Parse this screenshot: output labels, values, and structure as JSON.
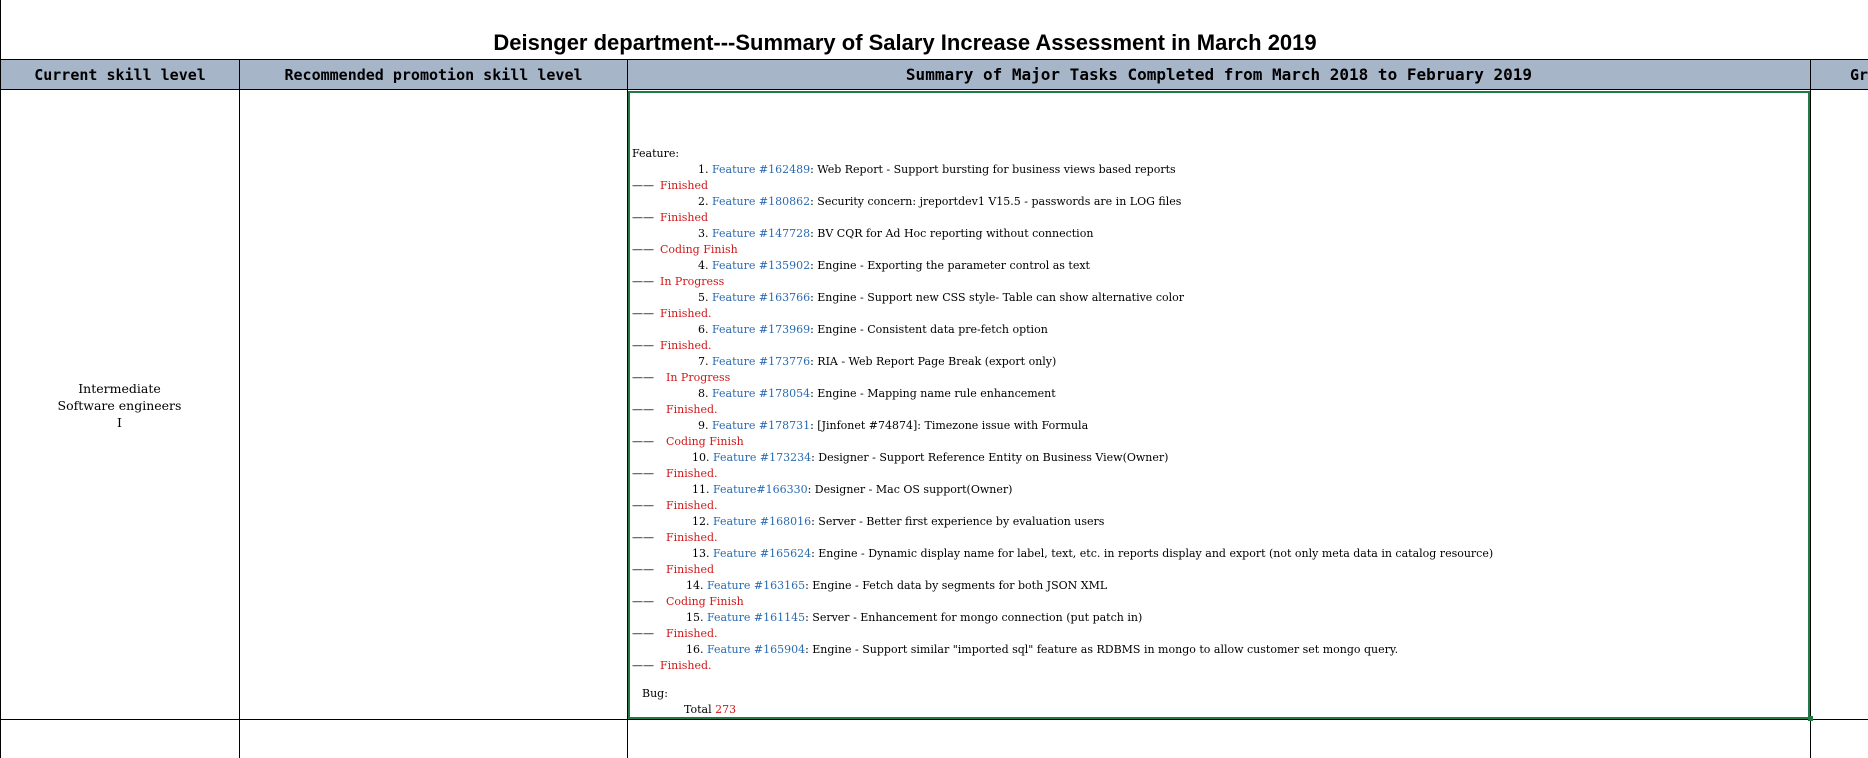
{
  "title": "Deisnger department---Summary of Salary Increase Assessment in March 2019",
  "headers": {
    "col1": "Current skill level",
    "col2": "Recommended promotion skill level",
    "col3": "Summary of Major Tasks Completed from March 2018 to February 2019",
    "col4_partial": "Gr"
  },
  "row": {
    "current_level": [
      "Intermediate",
      "Software engineers",
      "I"
    ],
    "recommended_level": ""
  },
  "tasks": {
    "feature_heading": "Feature:",
    "items": [
      {
        "num": "1.",
        "link": "Feature #162489",
        "desc": ": Web Report - Support bursting for business views based reports",
        "status": "Finished"
      },
      {
        "num": "2.",
        "link": "Feature #180862",
        "desc": ": Security concern: jreportdev1 V15.5 - passwords are in LOG files",
        "status": "Finished"
      },
      {
        "num": "3.",
        "link": "Feature #147728",
        "desc": ": BV CQR for Ad Hoc reporting without connection",
        "status": "Coding Finish"
      },
      {
        "num": "4.",
        "link": "Feature #135902",
        "desc": ": Engine - Exporting the parameter control as text",
        "status": "In Progress"
      },
      {
        "num": "5.",
        "link": "Feature #163766",
        "desc": ": Engine - Support new CSS style- Table can show alternative color",
        "status": "Finished."
      },
      {
        "num": "6.",
        "link": "Feature #173969",
        "desc": ": Engine - Consistent data pre-fetch option",
        "status": "Finished."
      },
      {
        "num": "7.",
        "link": "Feature #173776",
        "desc": ": RIA - Web Report Page Break (export only)",
        "status": "In Progress"
      },
      {
        "num": "8.",
        "link": "Feature #178054",
        "desc": ": Engine - Mapping name rule enhancement",
        "status": "Finished."
      },
      {
        "num": "9.",
        "link": "Feature #178731",
        "desc": ": [Jinfonet #74874]: Timezone issue with Formula",
        "status": "Coding Finish"
      },
      {
        "num": "10.",
        "link": "Feature #173234",
        "desc": ": Designer - Support Reference Entity on Business View(Owner)",
        "status": "Finished."
      },
      {
        "num": "11.",
        "link": "Feature#166330",
        "desc": ": Designer - Mac OS support(Owner)",
        "status": "Finished."
      },
      {
        "num": "12.",
        "link": "Feature #168016",
        "desc": ": Server - Better first experience by evaluation users",
        "status": "Finished."
      },
      {
        "num": "13.",
        "link": "Feature #165624",
        "desc": ": Engine - Dynamic display name for label, text, etc. in reports display and export (not only meta data in catalog resource)",
        "status": "Finished"
      },
      {
        "num": "14.",
        "link": "Feature #163165",
        "desc": ": Engine - Fetch data by segments for both JSON XML",
        "status": "Coding Finish"
      },
      {
        "num": "15.",
        "link": "Feature #161145",
        "desc": ": Server - Enhancement for mongo connection (put patch in)",
        "status": "Finished."
      },
      {
        "num": "16.",
        "link": "Feature #165904",
        "desc": ": Engine - Support similar \"imported sql\" feature as RDBMS in mongo to allow customer set mongo query.",
        "status": "Finished."
      }
    ],
    "status_prefix": "——",
    "bug_heading": "Bug:",
    "total_label": "Total",
    "total_value": "273"
  },
  "colors": {
    "header_bg": "#a7b5c9",
    "link": "#2a6bb0",
    "status": "#d01818",
    "selection_border": "#1f7a45"
  }
}
